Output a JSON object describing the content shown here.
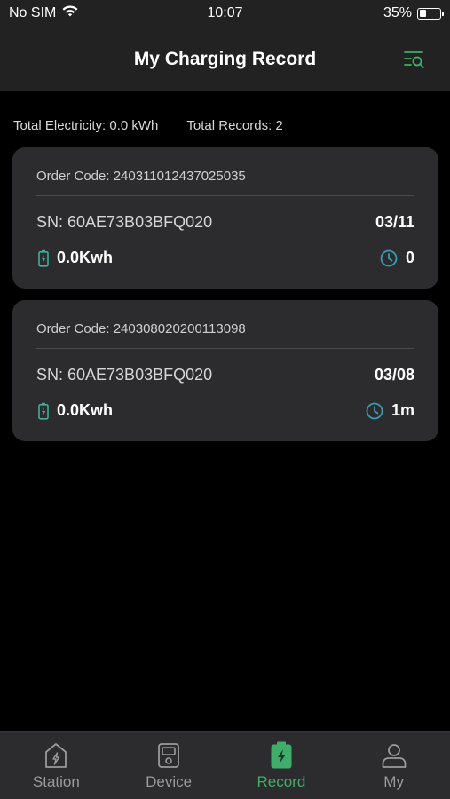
{
  "status_bar": {
    "carrier": "No SIM",
    "time": "10:07",
    "battery_percent": "35%",
    "battery_level": 0.35,
    "wifi_icon": "wifi-icon",
    "battery_icon": "battery-icon"
  },
  "header": {
    "title": "My Charging Record",
    "filter_icon": "filter-search-icon"
  },
  "summary": {
    "total_electricity": "Total Electricity: 0.0 kWh",
    "total_records": "Total Records: 2"
  },
  "records": [
    {
      "order_code": "Order Code: 240311012437025035",
      "sn": "SN: 60AE73B03BFQ020",
      "date": "03/11",
      "energy": "0.0Kwh",
      "duration": "0"
    },
    {
      "order_code": "Order Code: 240308020200113098",
      "sn": "SN: 60AE73B03BFQ020",
      "date": "03/08",
      "energy": "0.0Kwh",
      "duration": "1m"
    }
  ],
  "tabs": [
    {
      "label": "Station",
      "icon": "station-icon",
      "active": false
    },
    {
      "label": "Device",
      "icon": "device-icon",
      "active": false
    },
    {
      "label": "Record",
      "icon": "record-icon",
      "active": true
    },
    {
      "label": "My",
      "icon": "user-icon",
      "active": false
    }
  ],
  "colors": {
    "accent": "#3fae6a",
    "clock_icon": "#3a9bb0",
    "battery_icon": "#3fae9a",
    "card_bg": "#2c2c2e",
    "bar_bg": "#222222"
  }
}
